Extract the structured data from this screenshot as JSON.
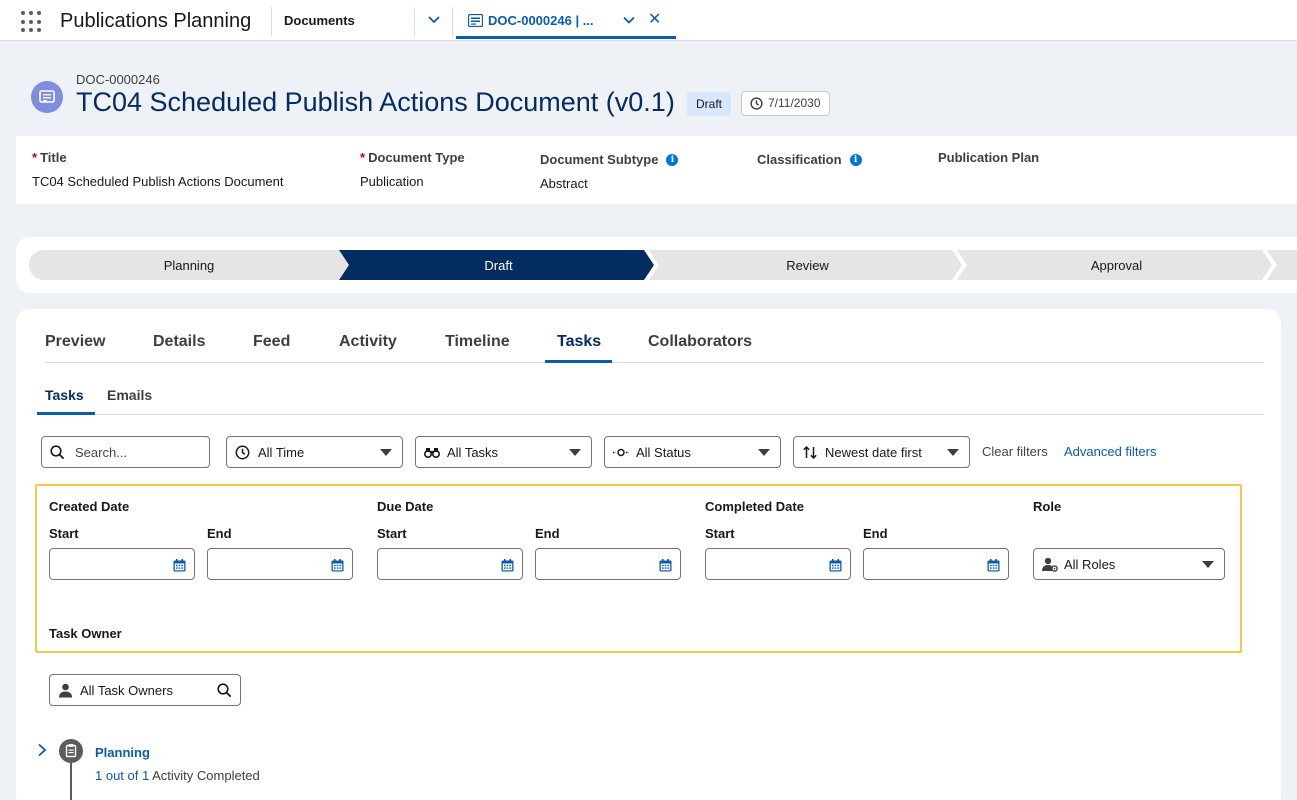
{
  "topbar": {
    "app_name": "Publications Planning",
    "nav_item": "Documents",
    "doc_tab_label": "DOC-0000246 | ...",
    "close_glyph": "✕"
  },
  "record": {
    "number": "DOC-0000246",
    "title": "TC04 Scheduled Publish Actions Document (v0.1)",
    "status_badge": "Draft",
    "date_badge": "7/11/2030",
    "icon": "document-icon"
  },
  "highlights": [
    {
      "label": "Title",
      "required": true,
      "info": false,
      "value": "TC04 Scheduled Publish Actions Document"
    },
    {
      "label": "Document Type",
      "required": true,
      "info": false,
      "value": "Publication"
    },
    {
      "label": "Document Subtype",
      "required": false,
      "info": true,
      "value": "Abstract"
    },
    {
      "label": "Classification",
      "required": false,
      "info": true,
      "value": ""
    },
    {
      "label": "Publication Plan",
      "required": false,
      "info": false,
      "value": ""
    }
  ],
  "path": {
    "stages": [
      "Planning",
      "Draft",
      "Review",
      "Approval"
    ],
    "current": "Draft"
  },
  "tabs": [
    "Preview",
    "Details",
    "Feed",
    "Activity",
    "Timeline",
    "Tasks",
    "Collaborators"
  ],
  "active_tab": "Tasks",
  "subtabs": [
    "Tasks",
    "Emails"
  ],
  "active_subtab": "Tasks",
  "filters": {
    "search_placeholder": "Search...",
    "time": "All Time",
    "tasks": "All Tasks",
    "status": "All Status",
    "sort": "Newest date first",
    "clear": "Clear filters",
    "advanced": "Advanced filters"
  },
  "advanced_filters": {
    "created_date": "Created Date",
    "due_date": "Due Date",
    "completed_date": "Completed Date",
    "role": "Role",
    "start": "Start",
    "end": "End",
    "role_value": "All Roles",
    "task_owner": "Task Owner",
    "task_owner_value": "All Task Owners"
  },
  "timeline": {
    "group_title": "Planning",
    "progress_link": "1 out of 1",
    "progress_text": " Activity Completed"
  },
  "colors": {
    "brand_blue": "#0b5cab",
    "path_active": "#032d60",
    "path_inactive": "#e5e5e5",
    "highlight_border": "#f2c94c"
  }
}
